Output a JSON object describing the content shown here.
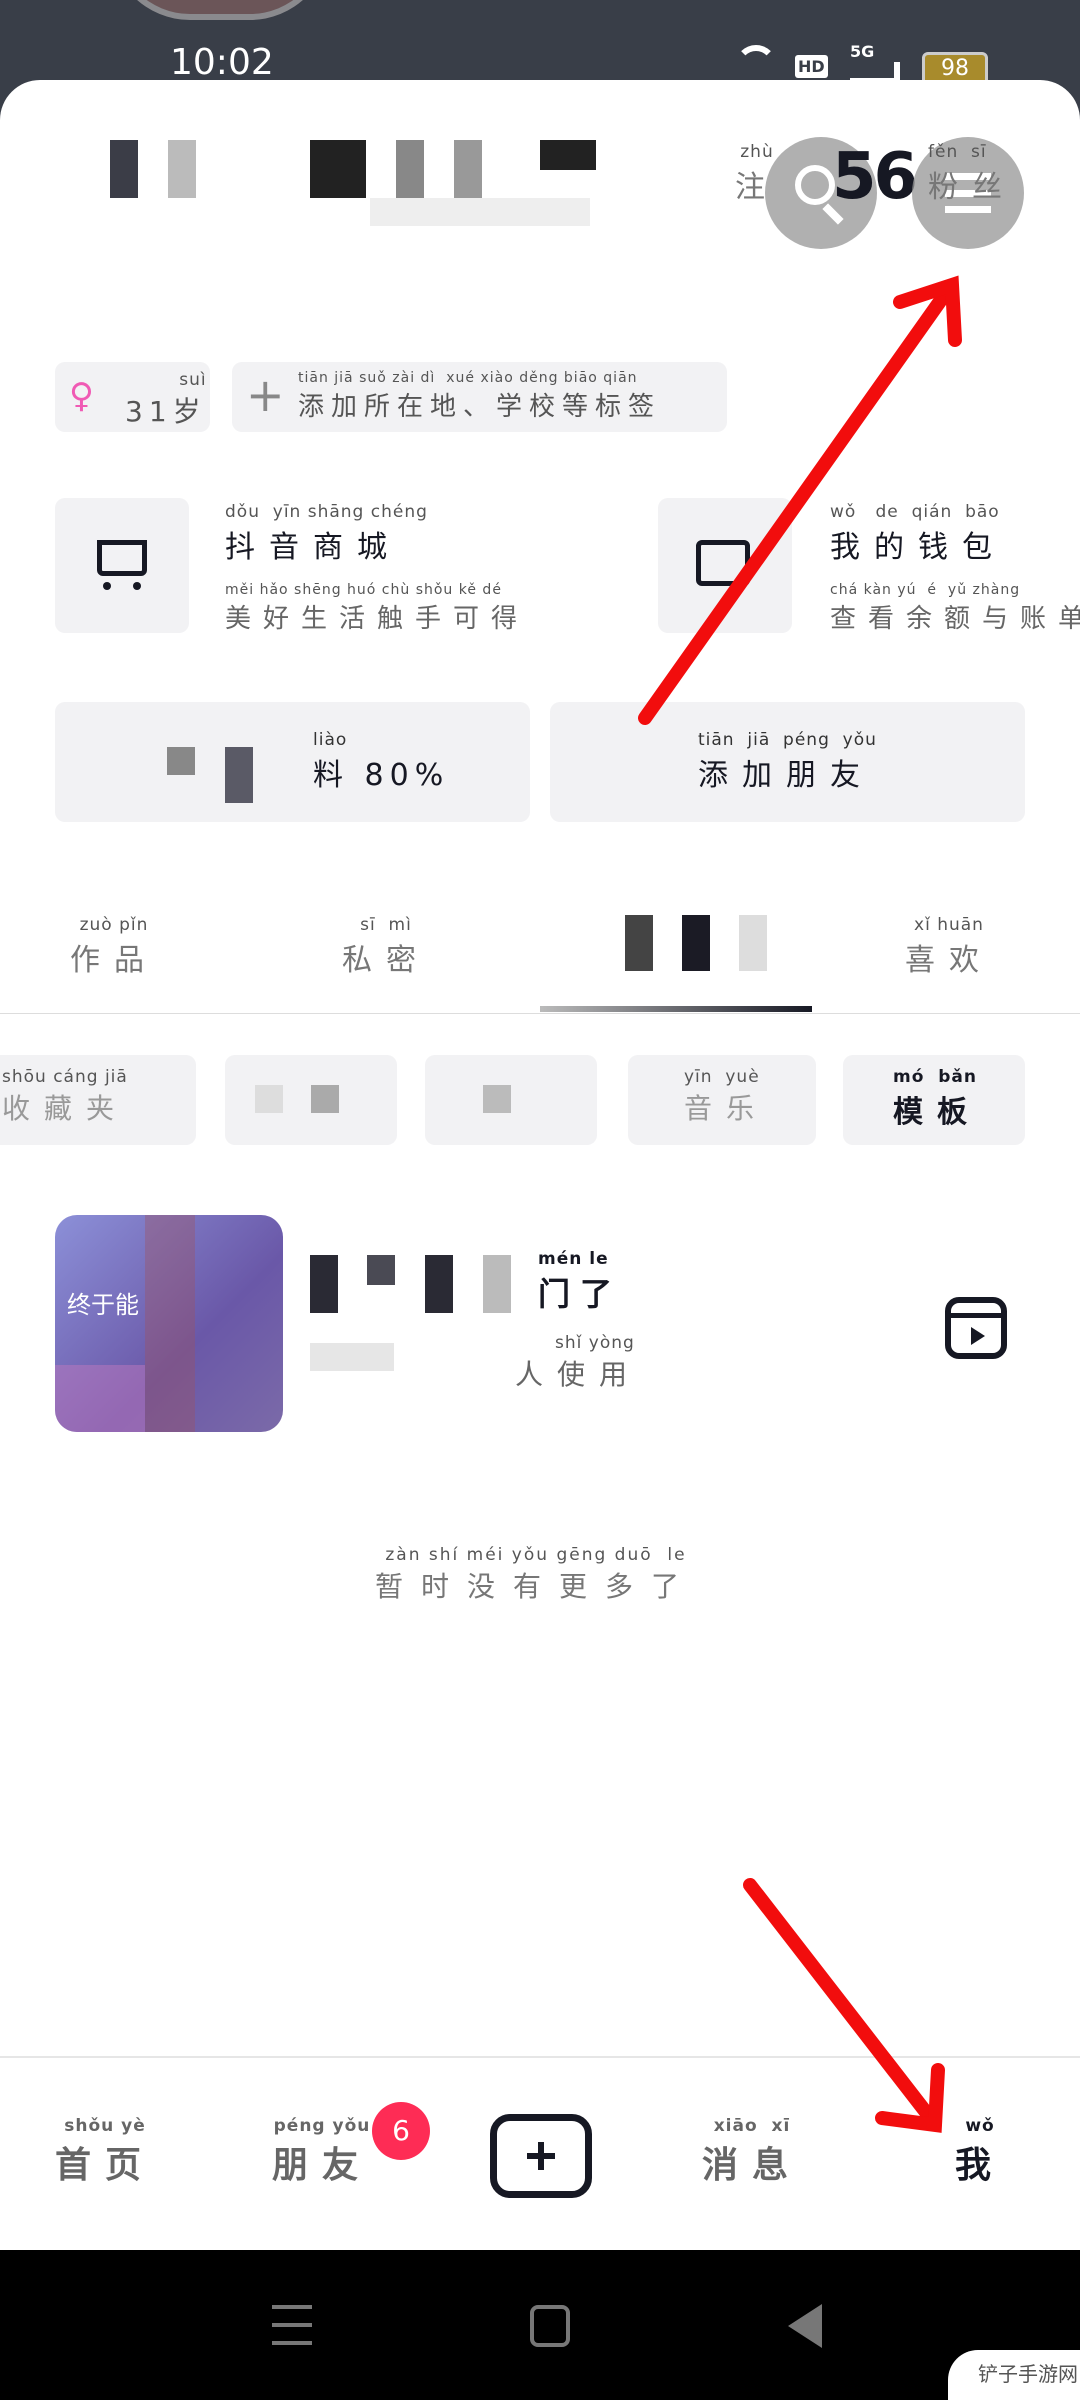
{
  "status_bar": {
    "time": "10:02",
    "battery": "98",
    "network": "5G",
    "hd": "HD"
  },
  "header": {
    "following_py": "zhù",
    "following_label": "注",
    "fans_count": "56",
    "fans_py": "fěn  sī",
    "fans_label": "粉丝"
  },
  "tags": {
    "age_py": "suì",
    "age_label": "31岁",
    "add_py": "tiān jiā suǒ zài dì  xué xiào děng biāo qiān",
    "add_label": "添加所在地、学校等标签"
  },
  "services": [
    {
      "title_py": "dǒu  yīn shāng chéng",
      "title": "抖音商城",
      "sub_py": "měi hǎo shēng huó chù shǒu kě dé",
      "sub": "美好生活触手可得",
      "icon": "cart-icon"
    },
    {
      "title_py": "wǒ   de  qián  bāo",
      "title": "我的钱包",
      "sub_py": "chá kàn yú  é  yǔ zhàng",
      "sub": "查看余额与账单",
      "icon": "wallet-icon"
    }
  ],
  "actions": {
    "edit_py": "liào",
    "edit_label": "料 80%",
    "add_friend_py": "tiān  jiā  péng  yǒu",
    "add_friend_label": "添加朋友"
  },
  "tabs": [
    {
      "py": "zuò pǐn",
      "label": "作品"
    },
    {
      "py": "sī  mì",
      "label": "私密"
    },
    {
      "py": "",
      "label": ""
    },
    {
      "py": "xǐ huān",
      "label": "喜欢"
    }
  ],
  "subtabs": [
    {
      "py": "shōu cáng jiā",
      "label": "收藏夹"
    },
    {
      "py": "",
      "label": ""
    },
    {
      "py": "",
      "label": ""
    },
    {
      "py": "yīn  yuè",
      "label": "音乐"
    },
    {
      "py": "mó  bǎn",
      "label": "模板"
    }
  ],
  "template_item": {
    "thumb_text": "终于能",
    "title_py": "mén le",
    "title": "门了",
    "sub_py": "shǐ yòng",
    "sub": "人使用",
    "icon": "reels-icon"
  },
  "empty_text_py": "zàn shí méi yǒu gēng duō  le",
  "empty_text": "暂时没有更多了",
  "bottom_nav": [
    {
      "py": "shǒu yè",
      "label": "首页"
    },
    {
      "py": "péng yǒu",
      "label": "朋友",
      "badge": "6"
    },
    {
      "py": "",
      "label": ""
    },
    {
      "py": "xiāo  xī",
      "label": "消息"
    },
    {
      "py": "wǒ",
      "label": "我"
    }
  ],
  "watermark": "铲子手游网",
  "colors": {
    "accent": "#fe2c55",
    "annotation": "#f20d0d",
    "status_bg": "#393e48"
  }
}
